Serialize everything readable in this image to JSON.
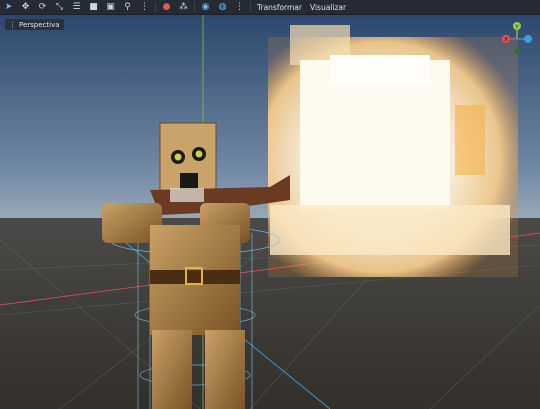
{
  "toolbar": {
    "tools": [
      {
        "name": "select-tool-icon",
        "glyph": "➤",
        "active": true
      },
      {
        "name": "move-tool-icon",
        "glyph": "✥"
      },
      {
        "name": "rotate-tool-icon",
        "glyph": "⟳"
      },
      {
        "name": "scale-tool-icon",
        "glyph": "⤡"
      },
      {
        "name": "list-select-icon",
        "glyph": "☰"
      },
      {
        "name": "lock-icon",
        "glyph": "🔒"
      },
      {
        "name": "group-icon",
        "glyph": "▣"
      },
      {
        "name": "bone-icon",
        "glyph": "⚲"
      },
      {
        "name": "snap-icon",
        "glyph": "⋮⋮"
      },
      {
        "name": "camera-icon",
        "glyph": "●",
        "red": true
      },
      {
        "name": "local-space-icon",
        "glyph": "⁂"
      },
      {
        "name": "snap-grid-icon",
        "glyph": "◉",
        "active": true
      },
      {
        "name": "globe-icon",
        "glyph": "◍",
        "active": true
      },
      {
        "name": "more-icon",
        "glyph": "⋮"
      }
    ],
    "menu_transform": "Transformar",
    "menu_view": "Visualizar"
  },
  "viewport": {
    "perspective_label": "Perspectiva",
    "gizmo": {
      "x": "X",
      "y": "Y",
      "z": "Z"
    }
  },
  "colors": {
    "sky_top": "#2f4a70",
    "sky_bottom": "#6e86a3",
    "ground": "#3c3a35",
    "axis_x": "#e0505a",
    "axis_z": "#3aa0d8",
    "axis_y": "#8ad14a"
  }
}
